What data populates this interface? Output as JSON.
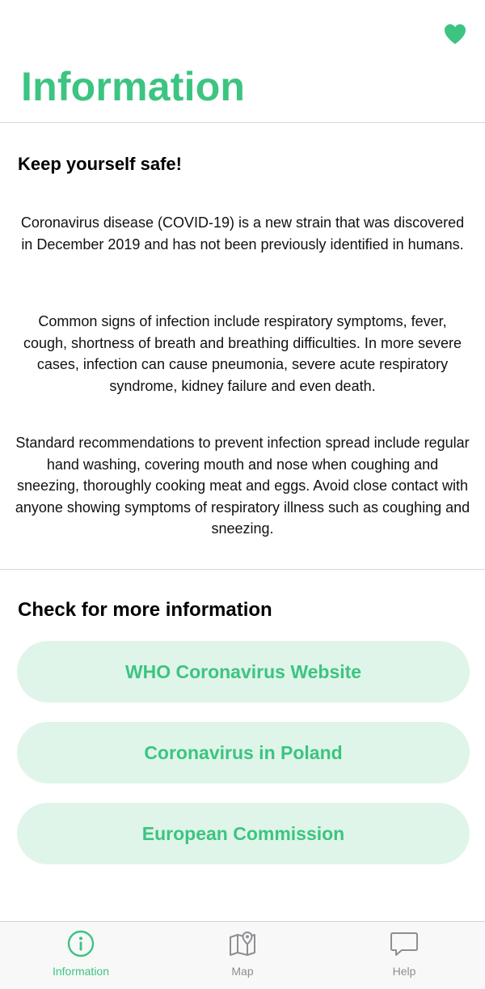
{
  "header": {
    "title": "Information",
    "favorite_icon": "heart-icon"
  },
  "intro": {
    "heading": "Keep yourself safe!",
    "paragraphs": [
      "Coronavirus disease (COVID-19) is a new strain that was discovered in December 2019 and has not been previously identified in humans.",
      "Common signs of infection include respiratory symptoms, fever, cough, shortness of breath and breathing difficulties. In more severe cases, infection can cause pneumonia, severe acute respiratory syndrome, kidney failure and even death.",
      "Standard recommendations to prevent infection spread include regular hand washing, covering mouth and nose when coughing and sneezing, thoroughly cooking meat and eggs. Avoid close contact with anyone showing symptoms of respiratory illness such as coughing and sneezing."
    ]
  },
  "more_info": {
    "heading": "Check for more information",
    "links": [
      {
        "label": "WHO Coronavirus Website"
      },
      {
        "label": "Coronavirus in Poland"
      },
      {
        "label": "European Commission"
      }
    ]
  },
  "tabbar": {
    "tabs": [
      {
        "label": "Information",
        "icon": "info-circle-icon",
        "active": true
      },
      {
        "label": "Map",
        "icon": "map-icon",
        "active": false
      },
      {
        "label": "Help",
        "icon": "speech-bubble-icon",
        "active": false
      }
    ]
  },
  "colors": {
    "accent": "#3cc481",
    "button_bg": "#e0f5e9",
    "inactive_tab": "#8e8e93"
  }
}
